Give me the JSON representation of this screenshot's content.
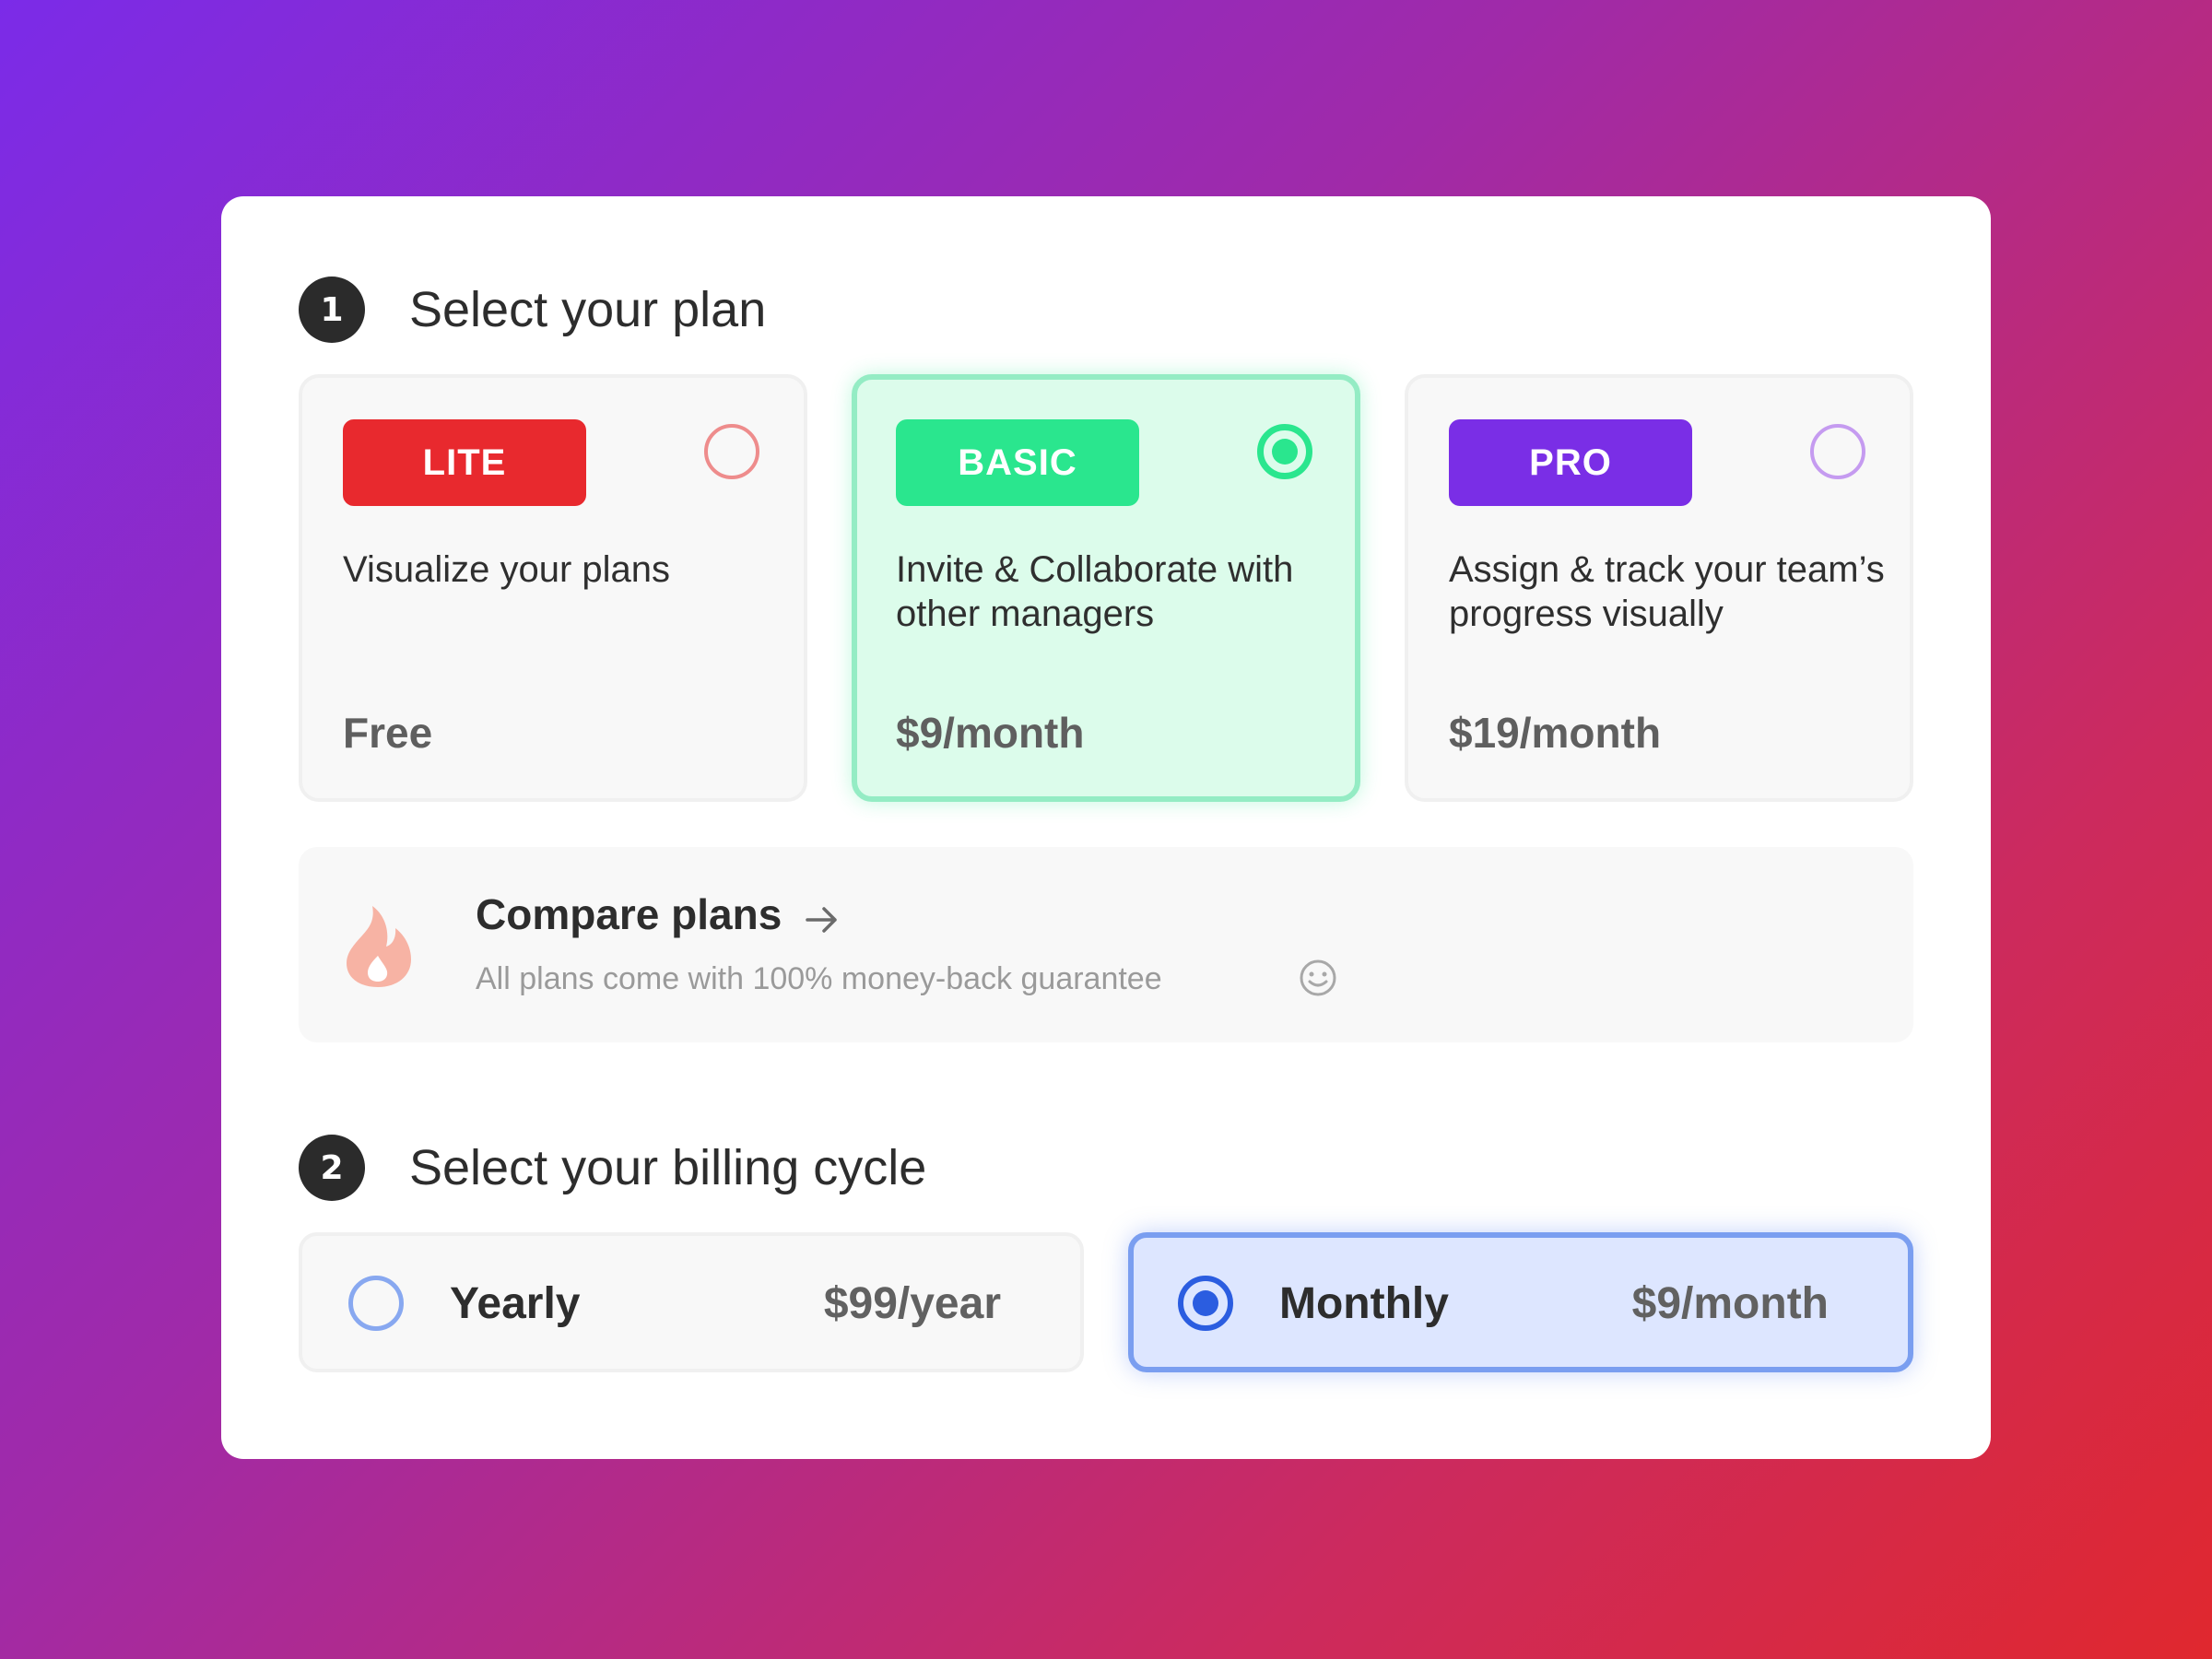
{
  "step1": {
    "number": "1",
    "title": "Select your plan"
  },
  "plans": [
    {
      "badge": "LITE",
      "description": "Visualize your plans",
      "price": "Free",
      "selected": false,
      "color": "#e8292e",
      "radio_color": "#ee8c8c"
    },
    {
      "badge": "BASIC",
      "description": "Invite & Collaborate with other managers",
      "price": "$9/month",
      "selected": true,
      "color": "#2ae68e",
      "radio_color": "#2ae68e"
    },
    {
      "badge": "PRO",
      "description": "Assign & track your team’s progress visually",
      "price": "$19/month",
      "selected": false,
      "color": "#7a2ee6",
      "radio_color": "#c59bf0"
    }
  ],
  "compare": {
    "icon": "flame-icon",
    "title": "Compare plans",
    "subtitle": "All plans come with 100% money-back guarantee",
    "accent_color": "#f7b3a4"
  },
  "step2": {
    "number": "2",
    "title": "Select your billing cycle"
  },
  "billing": [
    {
      "label": "Yearly",
      "price": "$99/year",
      "selected": false
    },
    {
      "label": "Monthly",
      "price": "$9/month",
      "selected": true,
      "accent": "#2b5de0"
    }
  ]
}
